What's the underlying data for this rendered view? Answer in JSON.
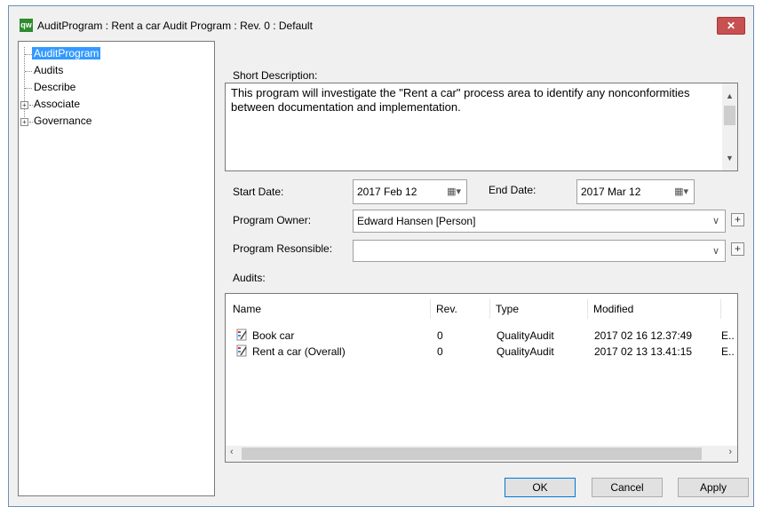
{
  "window": {
    "title": "AuditProgram : Rent a car Audit Program : Rev. 0  : Default",
    "app_icon_text": "qw",
    "close_glyph": "✕"
  },
  "tree": {
    "items": [
      {
        "label": "AuditProgram",
        "selected": true,
        "expandable": false
      },
      {
        "label": "Audits",
        "selected": false,
        "expandable": false
      },
      {
        "label": "Describe",
        "selected": false,
        "expandable": false
      },
      {
        "label": "Associate",
        "selected": false,
        "expandable": true
      },
      {
        "label": "Governance",
        "selected": false,
        "expandable": true
      }
    ]
  },
  "form": {
    "short_description_label": "Short Description:",
    "short_description_value": "This program will investigate the \"Rent a car\" process area to identify any nonconformities between documentation and implementation.",
    "start_date_label": "Start Date:",
    "start_date_value": "2017 Feb 12",
    "end_date_label": "End Date:",
    "end_date_value": "2017 Mar 12",
    "program_owner_label": "Program Owner:",
    "program_owner_value": "Edward Hansen [Person]",
    "program_responsible_label": "Program Resonsible:",
    "program_responsible_value": "",
    "audits_label": "Audits:"
  },
  "audits_table": {
    "columns": [
      "Name",
      "Rev.",
      "Type",
      "Modified"
    ],
    "rows": [
      {
        "name": "Book car",
        "rev": "0",
        "type": "QualityAudit",
        "modified": "2017 02 16 12.37:49",
        "extra": "E.."
      },
      {
        "name": "Rent a car (Overall)",
        "rev": "0",
        "type": "QualityAudit",
        "modified": "2017 02 13 13.41:15",
        "extra": "E.."
      }
    ]
  },
  "buttons": {
    "ok": "OK",
    "cancel": "Cancel",
    "apply": "Apply"
  },
  "colors": {
    "selection": "#3399ff",
    "close": "#c75050",
    "primary_border": "#0078d7"
  }
}
